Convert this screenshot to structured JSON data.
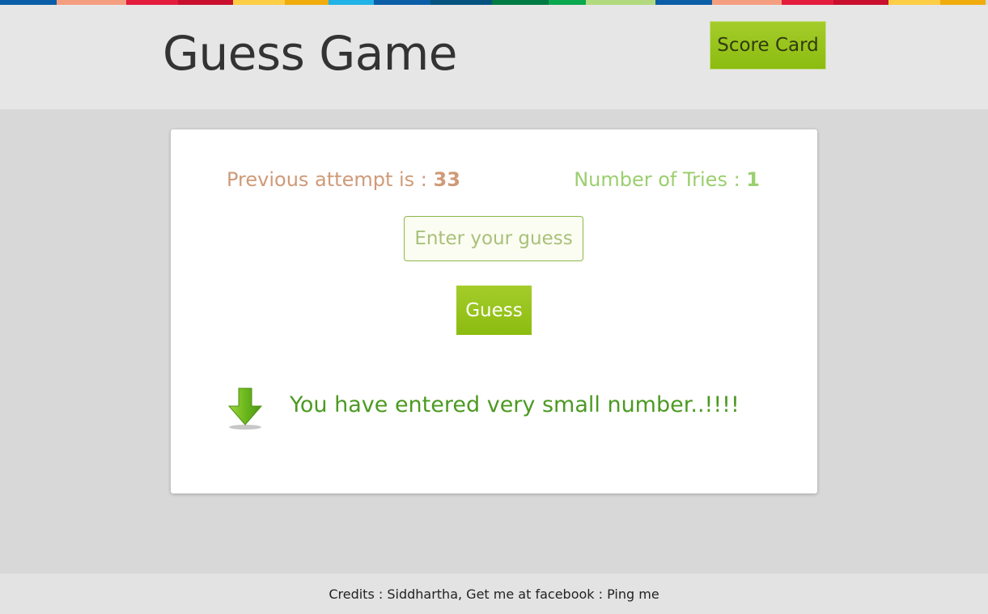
{
  "header": {
    "title": "Guess Game",
    "score_card_label": "Score Card",
    "strip_colors": [
      "#0a5ea8",
      "#f59e7f",
      "#e31c3d",
      "#c8102e",
      "#fdcd45",
      "#f0ac0c",
      "#1fb3e7",
      "#0b5ea6",
      "#05527f",
      "#017a44",
      "#0aa84f",
      "#b3d97e",
      "#0b5ea6",
      "#f59e7f",
      "#e31c3d",
      "#c8102e",
      "#fdcd45",
      "#f0ac0c"
    ]
  },
  "game": {
    "previous_attempt_label": "Previous attempt is : ",
    "previous_attempt_value": "33",
    "tries_label": "Number of Tries : ",
    "tries_value": "1",
    "input_placeholder": "Enter your guess",
    "input_value": "",
    "guess_button_label": "Guess",
    "hint_icon": "arrow-down-icon",
    "message": "You have entered very small number..!!!!"
  },
  "footer": {
    "credits_prefix": "Credits : Siddhartha, Get me at facebook : ",
    "ping_link": "Ping me"
  },
  "colors": {
    "accent_green": "#8cbc10",
    "previous_attempt": "#cf9a78",
    "tries": "#9bcf6e",
    "message": "#4c9a22"
  }
}
